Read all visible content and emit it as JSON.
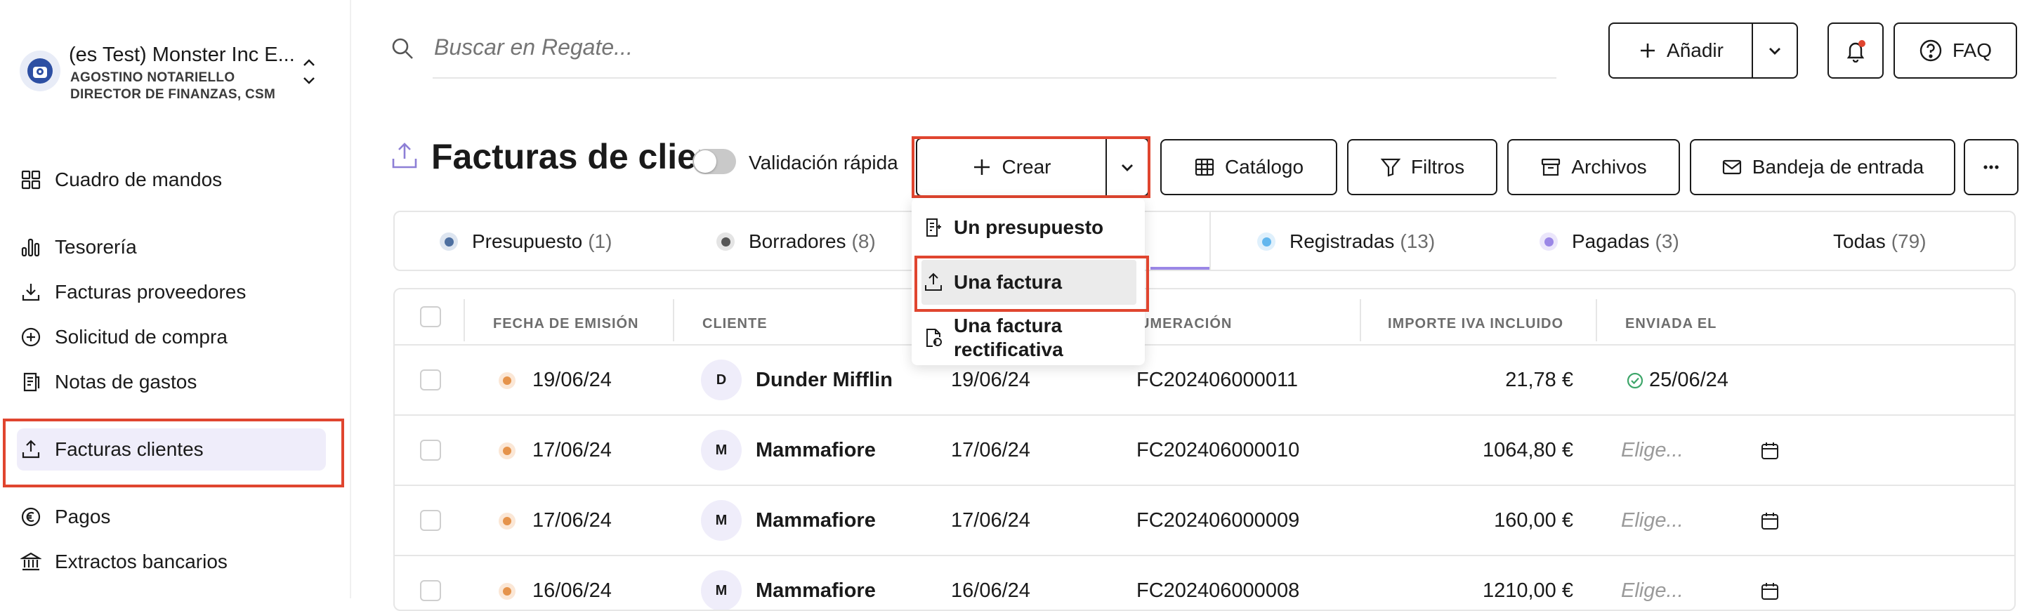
{
  "sidebar": {
    "org_name": "(es Test) Monster Inc E...",
    "user_name": "AGOSTINO NOTARIELLO",
    "user_role": "DIRECTOR DE FINANZAS, CSM",
    "items": [
      {
        "label": "Cuadro de mandos",
        "icon": "dashboard-icon"
      },
      {
        "label": "Tesorería",
        "icon": "bar-chart-icon"
      },
      {
        "label": "Facturas proveedores",
        "icon": "download-icon"
      },
      {
        "label": "Solicitud de compra",
        "icon": "plus-circle-icon"
      },
      {
        "label": "Notas de gastos",
        "icon": "receipt-icon"
      },
      {
        "label": "Facturas clientes",
        "icon": "upload-icon",
        "active": true
      },
      {
        "label": "Pagos",
        "icon": "euro-icon"
      },
      {
        "label": "Extractos bancarios",
        "icon": "bank-icon"
      }
    ]
  },
  "header": {
    "search_placeholder": "Buscar en Regate...",
    "add_label": "Añadir",
    "faq_label": "FAQ",
    "notification_dot_color": "#e0452f"
  },
  "page": {
    "title": "Facturas de clientes",
    "quick_validation_label": "Validación rápida",
    "toolbar": {
      "create_label": "Crear",
      "catalog_label": "Catálogo",
      "filters_label": "Filtros",
      "archives_label": "Archivos",
      "inbox_label": "Bandeja de entrada"
    }
  },
  "tabs": [
    {
      "label": "Presupuesto",
      "count": "(1)",
      "color": "#4d6fa0"
    },
    {
      "label": "Borradores",
      "count": "(8)",
      "color": "#555555"
    },
    {
      "label": "Registradas",
      "count": "(13)",
      "color": "#63b7ee"
    },
    {
      "label": "Pagadas",
      "count": "(3)",
      "color": "#9b87e6"
    },
    {
      "label": "Todas",
      "count": "(79)"
    }
  ],
  "dropdown": {
    "items": [
      {
        "label": "Un presupuesto"
      },
      {
        "label": "Una factura",
        "selected": true
      },
      {
        "label": "Una factura rectificativa"
      }
    ]
  },
  "table": {
    "headers": {
      "date": "FECHA DE EMISIÓN",
      "client": "CLIENTE",
      "numbering": "UMERACIÓN",
      "amount": "IMPORTE IVA INCLUIDO",
      "sent": "ENVIADA EL"
    },
    "rows": [
      {
        "date": "19/06/24",
        "initial": "D",
        "client": "Dunder Mifflin",
        "due": "19/06/24",
        "number": "FC202406000011",
        "amount": "21,78 €",
        "sent": "25/06/24"
      },
      {
        "date": "17/06/24",
        "initial": "M",
        "client": "Mammafiore",
        "due": "17/06/24",
        "number": "FC202406000010",
        "amount": "1064,80 €",
        "sent_placeholder": "Elige..."
      },
      {
        "date": "17/06/24",
        "initial": "M",
        "client": "Mammafiore",
        "due": "17/06/24",
        "number": "FC202406000009",
        "amount": "160,00 €",
        "sent_placeholder": "Elige..."
      },
      {
        "date": "16/06/24",
        "initial": "M",
        "client": "Mammafiore",
        "due": "16/06/24",
        "number": "FC202406000008",
        "amount": "1210,00 €",
        "sent_placeholder": "Elige..."
      }
    ]
  }
}
